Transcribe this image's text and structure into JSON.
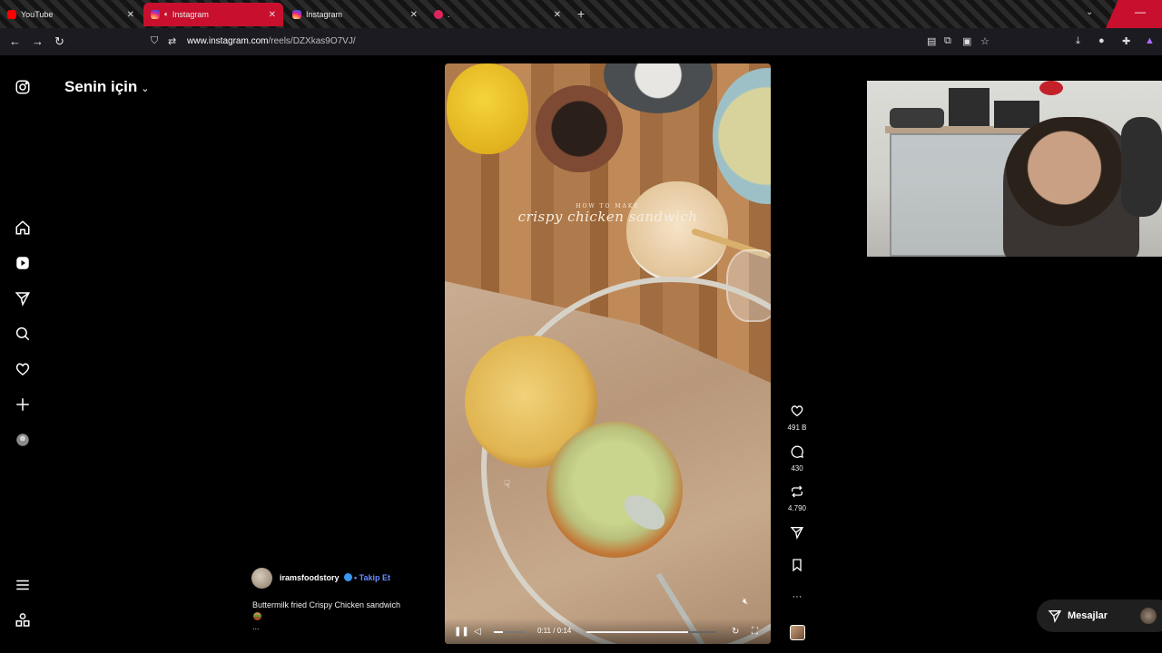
{
  "browser": {
    "tabs": [
      {
        "label": "YouTube",
        "favicon_color": "#ff0000"
      },
      {
        "label": "Instagram",
        "favicon_color": "#e1306c",
        "active": true
      },
      {
        "label": "Instagram",
        "favicon_color": "#e1306c"
      },
      {
        "label": ".",
        "favicon_color": "#e0245e"
      }
    ],
    "new_tab": "+",
    "tab_list": "⌄",
    "close_window": "—",
    "url_host": "www.instagram.com",
    "url_path": "/reels/DZXkas9O7VJ/"
  },
  "sidebar": {
    "feed_title": "Senin için",
    "items": [
      "instagram-logo",
      "home",
      "reels",
      "messages",
      "search",
      "notifications",
      "create",
      "profile",
      "more",
      "also-from-meta"
    ]
  },
  "reel": {
    "overlay_small": "HOW TO MAKE",
    "overlay_title": "crispy chicken sandwich",
    "time": "0:11 / 0:14",
    "progress": 0.79,
    "volume": 0.3,
    "muted": true,
    "username": "iramsfoodstory",
    "follow_label": "• Takip Et",
    "caption": "Buttermilk fried Crispy Chicken sandwich",
    "caption_more": "...",
    "verified_color": "#3897f0",
    "follow_color": "#6a8cff"
  },
  "actions": {
    "likes": "491 B",
    "comments": "430",
    "reposts": "4.790",
    "more": "···"
  },
  "messages": {
    "label": "Mesajlar"
  },
  "colors": {
    "tab_active": "#c8102e",
    "background": "#000000",
    "toolbar": "#1c1b22"
  }
}
